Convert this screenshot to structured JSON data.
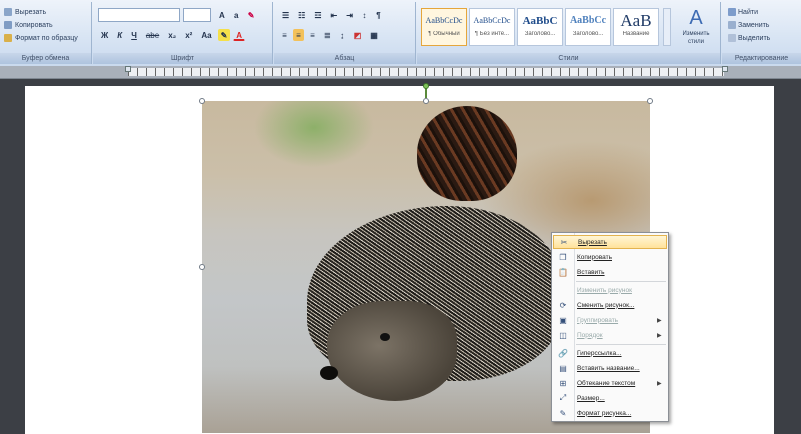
{
  "clipboard": {
    "items": [
      {
        "icon": "cut-icon",
        "label": "Вырезать"
      },
      {
        "icon": "copy-icon",
        "label": "Копировать"
      },
      {
        "icon": "format-painter-icon",
        "label": "Формат по образцу"
      }
    ],
    "group_label": "Буфер обмена"
  },
  "font": {
    "name_value": "",
    "size_value": "",
    "grow": "A",
    "shrink": "a",
    "buttons": [
      "Ж",
      "К",
      "Ч",
      "abe",
      "x₂",
      "x²",
      "Aa"
    ],
    "group_label": "Шрифт"
  },
  "paragraph": {
    "group_label": "Абзац"
  },
  "styles": {
    "tiles": [
      {
        "sample": "AaBbCcDc",
        "name": "¶ Обычный",
        "selected": true
      },
      {
        "sample": "AaBbCcDc",
        "name": "¶ Без инте...",
        "selected": false
      },
      {
        "sample": "AaBbC",
        "name": "Заголово...",
        "selected": false
      },
      {
        "sample": "AaBbCc",
        "name": "Заголово...",
        "selected": false
      },
      {
        "sample": "AaB",
        "name": "Название",
        "selected": false
      }
    ],
    "change_styles_label": "Изменить стили",
    "group_label": "Стили"
  },
  "editing": {
    "find": "Найти",
    "replace": "Заменить",
    "select": "Выделить",
    "group_label": "Редактирование"
  },
  "context_menu": {
    "items": [
      {
        "icon": "cut-icon",
        "label": "Вырезать",
        "highlighted": true,
        "disabled": false,
        "submenu": false
      },
      {
        "icon": "copy-icon",
        "label": "Копировать",
        "highlighted": false,
        "disabled": false,
        "submenu": false
      },
      {
        "icon": "paste-icon",
        "label": "Вставить",
        "highlighted": false,
        "disabled": false,
        "submenu": false
      },
      {
        "icon": "",
        "label": "Изменить рисунок",
        "highlighted": false,
        "disabled": true,
        "submenu": false,
        "sep_before": true
      },
      {
        "icon": "change-picture-icon",
        "label": "Сменить рисунок...",
        "highlighted": false,
        "disabled": false,
        "submenu": false
      },
      {
        "icon": "group-icon",
        "label": "Группировать",
        "highlighted": false,
        "disabled": true,
        "submenu": true
      },
      {
        "icon": "order-icon",
        "label": "Порядок",
        "highlighted": false,
        "disabled": true,
        "submenu": true
      },
      {
        "icon": "hyperlink-icon",
        "label": "Гиперссылка...",
        "highlighted": false,
        "disabled": false,
        "submenu": false,
        "sep_before": true
      },
      {
        "icon": "caption-icon",
        "label": "Вставить название...",
        "highlighted": false,
        "disabled": false,
        "submenu": false
      },
      {
        "icon": "wrap-text-icon",
        "label": "Обтекание текстом",
        "highlighted": false,
        "disabled": false,
        "submenu": true
      },
      {
        "icon": "size-icon",
        "label": "Размер...",
        "highlighted": false,
        "disabled": false,
        "submenu": false
      },
      {
        "icon": "format-picture-icon",
        "label": "Формат рисунка...",
        "highlighted": false,
        "disabled": false,
        "submenu": false
      }
    ]
  }
}
